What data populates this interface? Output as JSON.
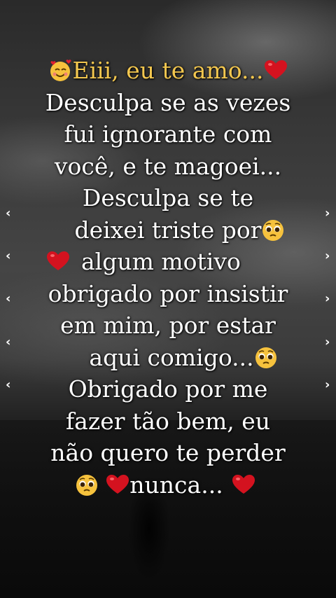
{
  "message": {
    "title": "Eiii, eu te amo...",
    "lines": [
      "Desculpa se as vezes",
      "fui ignorante com",
      "você, e te magoei...",
      "Desculpa se te",
      "deixei triste por",
      "algum motivo",
      "obrigado por insistir",
      "em mim, por estar",
      "aqui comigo...",
      "Obrigado por me",
      "fazer tão bem, eu",
      "não quero te perder",
      "nunca..."
    ]
  },
  "colors": {
    "title": "#f3c74f",
    "text": "#ffffff",
    "heart": "#d4121f",
    "face": "#f6c23d"
  },
  "icons": {
    "title_start": "smiling-face-with-hearts-icon",
    "heart": "red-heart-icon",
    "pleading": "pleading-face-icon",
    "left_arrow": "chevron-left-icon",
    "right_arrow": "chevron-right-icon"
  }
}
